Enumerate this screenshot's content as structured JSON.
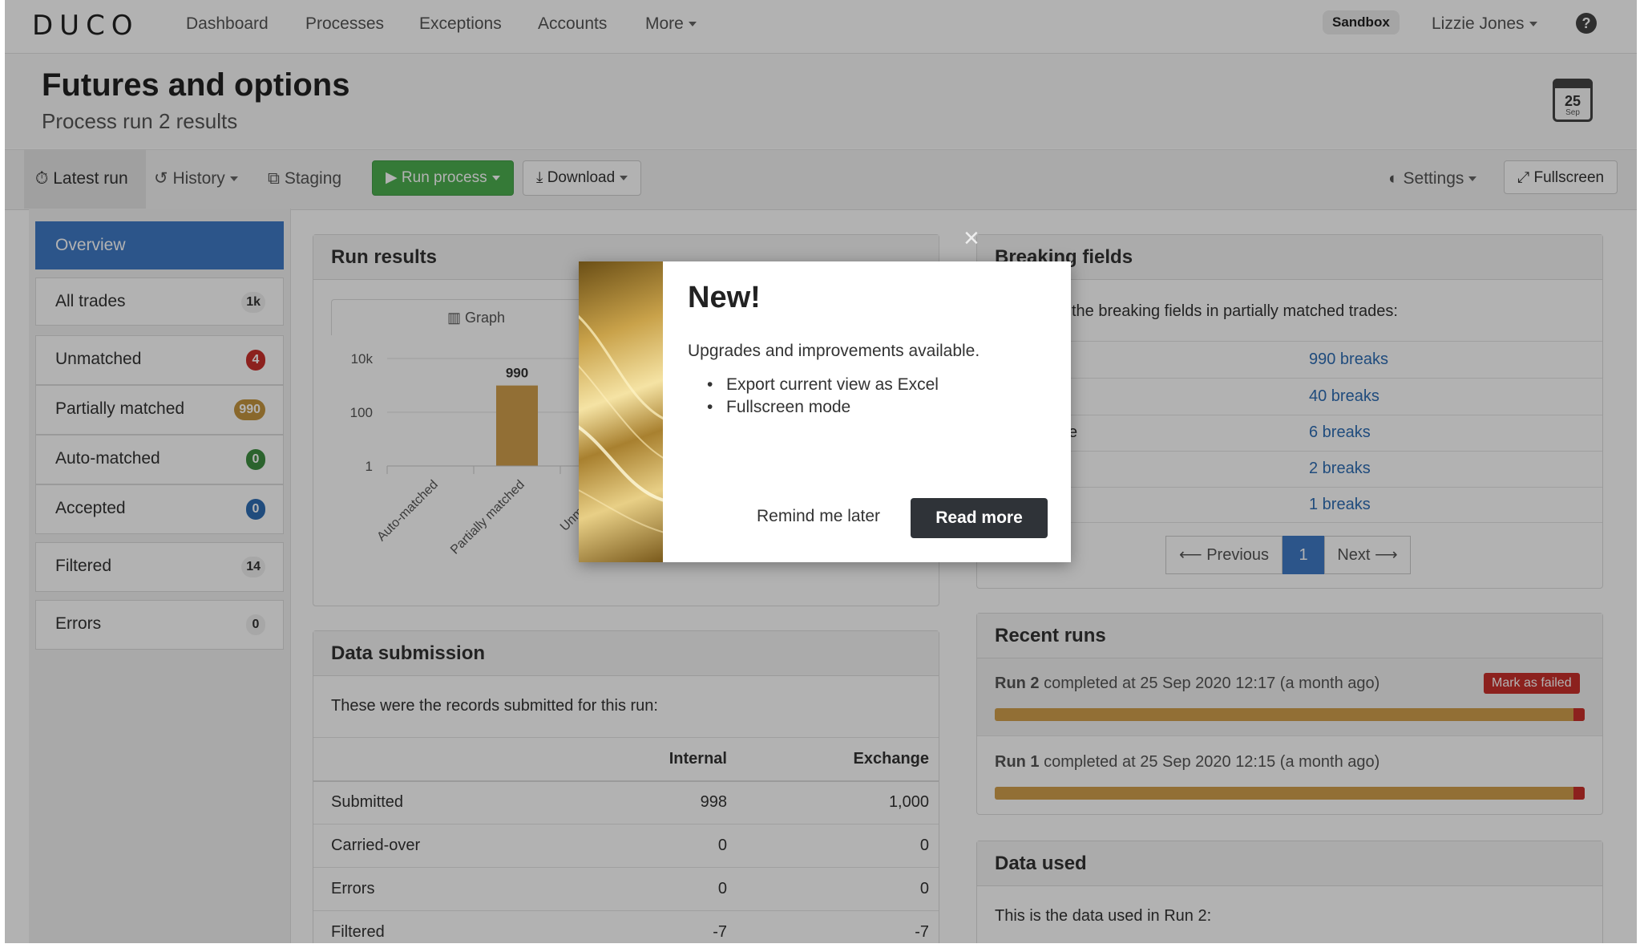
{
  "app": {
    "logo": "DUCO",
    "nav": [
      "Dashboard",
      "Processes",
      "Exceptions",
      "Accounts",
      "More"
    ],
    "env_badge": "Sandbox",
    "user": "Lizzie Jones",
    "help_glyph": "?"
  },
  "header": {
    "title": "Futures and options",
    "subtitle": "Process run 2 results",
    "calendar_day": "25",
    "calendar_month": "Sep"
  },
  "toolbar": {
    "latest_run": "Latest run",
    "history": "History",
    "staging": "Staging",
    "run_process": "Run process",
    "download": "Download",
    "settings": "Settings",
    "fullscreen": "Fullscreen"
  },
  "sidebar": {
    "items": [
      {
        "label": "Overview",
        "badge": ""
      },
      {
        "label": "All trades",
        "badge": "1k"
      },
      {
        "label": "Unmatched",
        "badge": "4"
      },
      {
        "label": "Partially matched",
        "badge": "990"
      },
      {
        "label": "Auto-matched",
        "badge": "0"
      },
      {
        "label": "Accepted",
        "badge": "0"
      },
      {
        "label": "Filtered",
        "badge": "14"
      },
      {
        "label": "Errors",
        "badge": "0"
      }
    ]
  },
  "run_results": {
    "title": "Run results",
    "tab_graph": "Graph"
  },
  "chart_data": {
    "type": "bar",
    "categories": [
      "Auto-matched",
      "Partially matched",
      "Unmatched"
    ],
    "values": [
      0,
      990,
      4
    ],
    "value_labels": [
      "",
      "990",
      ""
    ],
    "yscale": "log",
    "yticks": [
      "1",
      "100",
      "10k"
    ],
    "ylim": [
      1,
      10000
    ],
    "bar_color": "#d19f4c"
  },
  "data_submission": {
    "title": "Data submission",
    "intro": "These were the records submitted for this run:",
    "columns": [
      "Internal",
      "Exchange"
    ],
    "rows": [
      {
        "label": "Submitted",
        "internal": "998",
        "exchange": "1,000"
      },
      {
        "label": "Carried-over",
        "internal": "0",
        "exchange": "0"
      },
      {
        "label": "Errors",
        "internal": "0",
        "exchange": "0"
      },
      {
        "label": "Filtered",
        "internal": "-7",
        "exchange": "-7"
      }
    ]
  },
  "breaking_fields": {
    "title": "Breaking fields",
    "intro": "the breaking fields in partially matched trades:",
    "partial_label": "e",
    "breaks": [
      "990 breaks",
      "40 breaks",
      "6 breaks",
      "2 breaks",
      "1 breaks"
    ],
    "pager": {
      "prev": "Previous",
      "current": "1",
      "next": "Next"
    }
  },
  "recent_runs": {
    "title": "Recent runs",
    "runs": [
      {
        "name": "Run 2",
        "text": "completed at 25 Sep 2020 12:17 (a month ago)",
        "action": "Mark as failed"
      },
      {
        "name": "Run 1",
        "text": "completed at 25 Sep 2020 12:15 (a month ago)"
      }
    ]
  },
  "data_used": {
    "title": "Data used",
    "intro": "This is the data used in Run 2:"
  },
  "modal": {
    "heading": "New!",
    "body": "Upgrades and improvements available.",
    "bullets": [
      "Export current view as Excel",
      "Fullscreen mode"
    ],
    "remind": "Remind me later",
    "read_more": "Read more",
    "close": "×"
  },
  "colors": {
    "primary": "#3f7ac6",
    "success": "#4caf50",
    "danger": "#c9302c",
    "gold": "#d19f4c"
  }
}
